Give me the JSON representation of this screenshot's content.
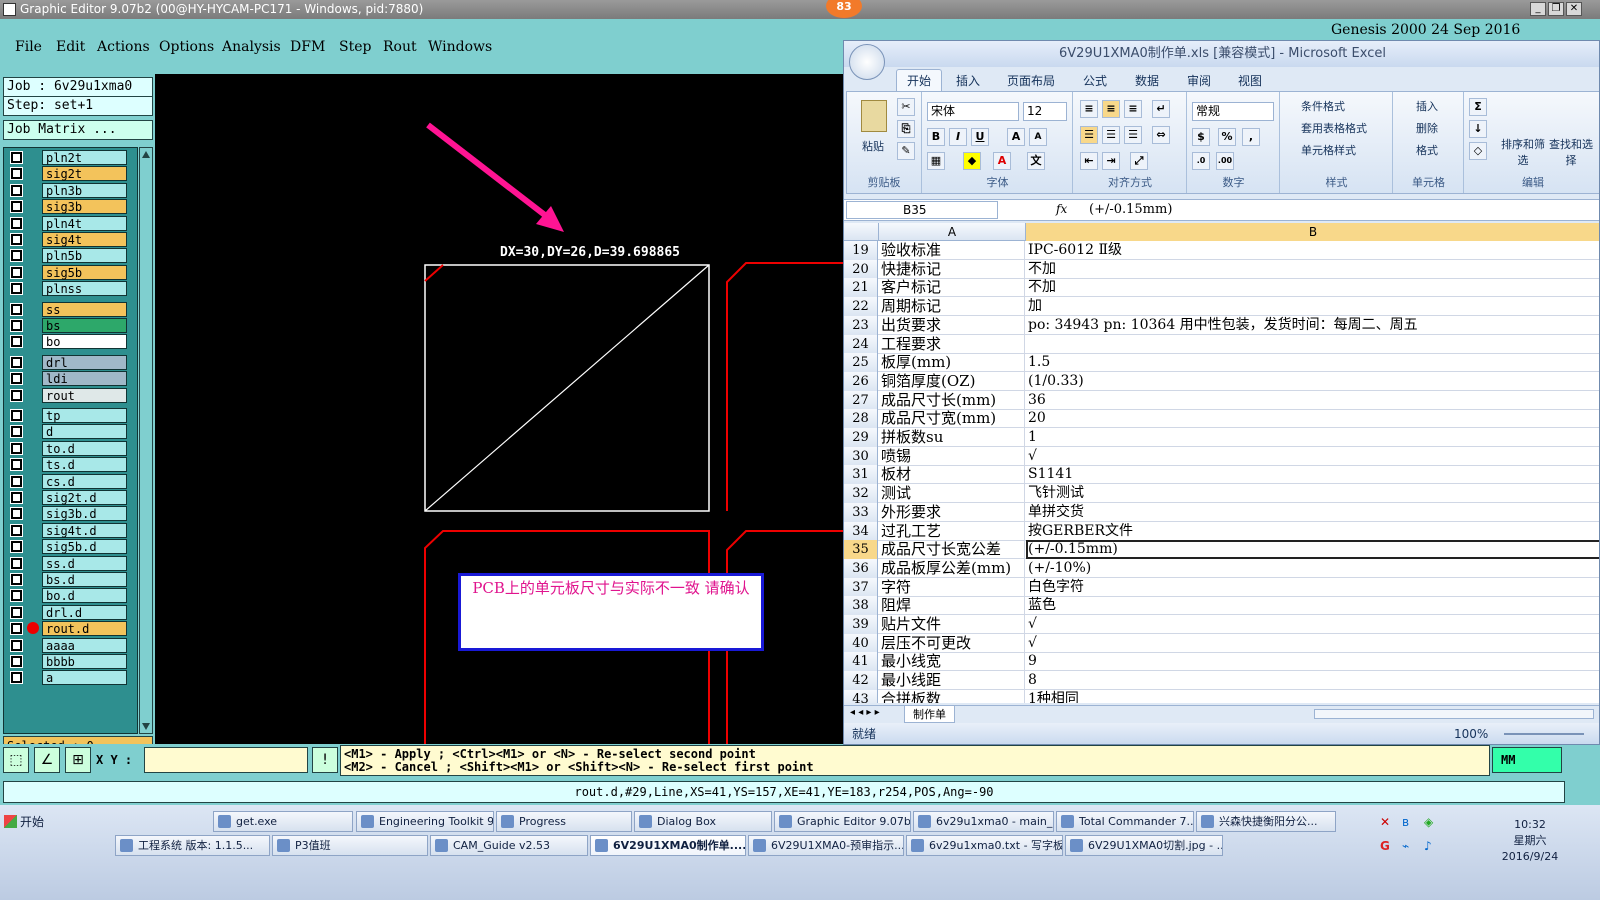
{
  "window": {
    "title": "Graphic Editor 9.07b2 (00@HY-HYCAM-PC171 - Windows, pid:7880)",
    "badge": "83"
  },
  "menu": [
    "File",
    "Edit",
    "Actions",
    "Options",
    "Analysis",
    "DFM",
    "Step",
    "Rout",
    "Windows"
  ],
  "banner": "Genesis 2000 24 Sep 2016",
  "job": {
    "job_label": "Job : 6v29u1xma0",
    "step_label": "Step: set+1",
    "matrix_button": "Job Matrix ..."
  },
  "layers": [
    {
      "name": "pln2t",
      "color": "#a8e8e8"
    },
    {
      "name": "sig2t",
      "color": "#f3c35b"
    },
    {
      "name": "pln3b",
      "color": "#a8e8e8"
    },
    {
      "name": "sig3b",
      "color": "#f3c35b"
    },
    {
      "name": "pln4t",
      "color": "#a8e8e8"
    },
    {
      "name": "sig4t",
      "color": "#f3c35b"
    },
    {
      "name": "pln5b",
      "color": "#a8e8e8"
    },
    {
      "name": "sig5b",
      "color": "#f3c35b"
    },
    {
      "name": "plnss",
      "color": "#a8e8e8"
    },
    {
      "name": "ss",
      "color": "#f3c35b"
    },
    {
      "name": "bs",
      "color": "#2da86a"
    },
    {
      "name": "bo",
      "color": "#ffffff"
    },
    {
      "name": "drl",
      "color": "#a0b8c8"
    },
    {
      "name": "ldi",
      "color": "#a0b8c8"
    },
    {
      "name": "rout",
      "color": "#dfe8e8"
    },
    {
      "name": "tp",
      "color": "#a8e8e8"
    },
    {
      "name": "d",
      "color": "#a8e8e8"
    },
    {
      "name": "to.d",
      "color": "#a8e8e8"
    },
    {
      "name": "ts.d",
      "color": "#a8e8e8"
    },
    {
      "name": "cs.d",
      "color": "#a8e8e8"
    },
    {
      "name": "sig2t.d",
      "color": "#a8e8e8"
    },
    {
      "name": "sig3b.d",
      "color": "#a8e8e8"
    },
    {
      "name": "sig4t.d",
      "color": "#a8e8e8"
    },
    {
      "name": "sig5b.d",
      "color": "#a8e8e8"
    },
    {
      "name": "ss.d",
      "color": "#a8e8e8"
    },
    {
      "name": "bs.d",
      "color": "#a8e8e8"
    },
    {
      "name": "bo.d",
      "color": "#a8e8e8"
    },
    {
      "name": "drl.d",
      "color": "#a8e8e8"
    },
    {
      "name": "rout.d",
      "color": "#f3c35b"
    },
    {
      "name": "aaaa",
      "color": "#a8e8e8"
    },
    {
      "name": "bbbb",
      "color": "#a8e8e8"
    },
    {
      "name": "a",
      "color": "#a8e8e8"
    }
  ],
  "selected_label": "Selected : 0",
  "canvas": {
    "measure": "DX=30,DY=26,D=39.698865",
    "note": "PCB上的单元板尺寸与实际不一致 请确认"
  },
  "toolbar": {
    "xy_label": "X Y :",
    "hint_line1": "<M1> - Apply  ; <Ctrl><M1> or <N> - Re-select second point",
    "hint_line2": "<M2> - Cancel ; <Shift><M1> or <Shift><N> - Re-select first point",
    "units": "MM"
  },
  "status_line": "rout.d,#29,Line,XS=41,YS=157,XE=41,YE=183,r254,POS,Ang=-90",
  "excel": {
    "title": "6V29U1XMA0制作单.xls  [兼容模式] - Microsoft Excel",
    "tabs": [
      "开始",
      "插入",
      "页面布局",
      "公式",
      "数据",
      "审阅",
      "视图"
    ],
    "ribbon": {
      "paste": "粘贴",
      "clipboard": "剪贴板",
      "font_name": "宋体",
      "font_size": "12",
      "font_group": "字体",
      "align_group": "对齐方式",
      "number_format": "常规",
      "number_group": "数字",
      "cond_format": "条件格式",
      "table_format": "套用表格格式",
      "cell_style": "单元格样式",
      "style_group": "样式",
      "insert": "插入",
      "delete": "删除",
      "format": "格式",
      "cells_group": "单元格",
      "sort": "排序和筛选",
      "find": "查找和选择",
      "edit_group": "编辑"
    },
    "name_box": "B35",
    "formula": "(+/-0.15mm)",
    "columns": [
      "A",
      "B"
    ],
    "rows": [
      {
        "n": "19",
        "a": "验收标准",
        "b": "IPC-6012 Ⅱ级"
      },
      {
        "n": "20",
        "a": "快捷标记",
        "b": "不加"
      },
      {
        "n": "21",
        "a": "客户标记",
        "b": "不加"
      },
      {
        "n": "22",
        "a": "周期标记",
        "b": "加"
      },
      {
        "n": "23",
        "a": "出货要求",
        "b": "po: 34943 pn: 10364 用中性包装，发货时间：每周二、周五"
      },
      {
        "n": "24",
        "a": "工程要求",
        "b": ""
      },
      {
        "n": "25",
        "a": "板厚(mm)",
        "b": "1.5"
      },
      {
        "n": "26",
        "a": "铜箔厚度(OZ)",
        "b": "(1/0.33)"
      },
      {
        "n": "27",
        "a": "成品尺寸长(mm)",
        "b": "36"
      },
      {
        "n": "28",
        "a": "成品尺寸宽(mm)",
        "b": "20"
      },
      {
        "n": "29",
        "a": "拼板数su",
        "b": "1"
      },
      {
        "n": "30",
        "a": "喷锡",
        "b": "√"
      },
      {
        "n": "31",
        "a": "板材",
        "b": "S1141"
      },
      {
        "n": "32",
        "a": "测试",
        "b": "飞针测试"
      },
      {
        "n": "33",
        "a": "外形要求",
        "b": "单拼交货"
      },
      {
        "n": "34",
        "a": "过孔工艺",
        "b": "按GERBER文件"
      },
      {
        "n": "35",
        "a": "成品尺寸长宽公差",
        "b": "(+/-0.15mm)"
      },
      {
        "n": "36",
        "a": "成品板厚公差(mm)",
        "b": "(+/-10%)"
      },
      {
        "n": "37",
        "a": "字符",
        "b": "白色字符"
      },
      {
        "n": "38",
        "a": "阻焊",
        "b": "蓝色"
      },
      {
        "n": "39",
        "a": "贴片文件",
        "b": "√"
      },
      {
        "n": "40",
        "a": "层压不可更改",
        "b": "√"
      },
      {
        "n": "41",
        "a": "最小线宽",
        "b": "9"
      },
      {
        "n": "42",
        "a": "最小线距",
        "b": "8"
      },
      {
        "n": "43",
        "a": "合拼板数",
        "b": "1种相同"
      }
    ],
    "sheet_tab": "制作单",
    "status": "就绪",
    "zoom": "100%"
  },
  "taskbar": {
    "start": "开始",
    "row1": [
      "get.exe",
      "Engineering Toolkit 9...",
      "Progress",
      "Dialog Box",
      "Graphic Editor 9.07b...",
      "6v29u1xma0 - main_qa",
      "Total Commander 7....",
      "兴森快捷衡阳分公..."
    ],
    "row2": [
      "工程系统  版本: 1.1.5...",
      "P3值班",
      "CAM_Guide v2.53",
      "6V29U1XMA0制作单....",
      "6V29U1XMA0-预审指示...",
      "6v29u1xma0.txt - 写字板",
      "6V29U1XMA0切割.jpg - ..."
    ],
    "time": "10:32",
    "weekday": "星期六",
    "date": "2016/9/24"
  }
}
